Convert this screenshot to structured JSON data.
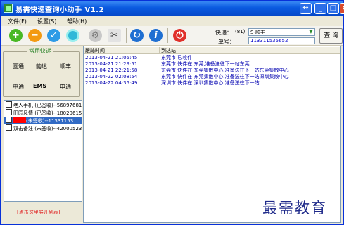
{
  "window": {
    "title": "易需快递查询小助手 V1.2"
  },
  "menu": [
    "文件(F)",
    "设置(S)",
    "帮助(H)"
  ],
  "toolbar_icons": [
    "add-icon",
    "minus-icon",
    "check-icon",
    "circle-icon",
    "gear-icon",
    "tools-icon",
    "refresh-icon",
    "info-icon",
    "power-icon"
  ],
  "query": {
    "courier_label": "快递：",
    "courier_count": "(81)",
    "courier_value": "S-顺丰",
    "number_label": "单号：",
    "number_value": "113311535652",
    "button": "查 询"
  },
  "quick": {
    "title": "常用快递",
    "items": [
      "圆通",
      "韵达",
      "顺丰",
      "中通",
      "EMS",
      "申通"
    ]
  },
  "records": [
    {
      "text": "老人手机 (已签收)--56897681",
      "selected": false
    },
    {
      "text": "田园风情 (已签收)--18020615",
      "selected": false
    },
    {
      "text": "(未签收)--11331153",
      "selected": true
    },
    {
      "text": "双击备注 (未签收)--42000523",
      "selected": false
    }
  ],
  "hide_link": "[点击这里展开列表]",
  "table": {
    "headers": [
      "跟踪时间",
      "到达站"
    ],
    "rows": [
      [
        "2013-04-21 21:05:45",
        "东莞市 已收件"
      ],
      [
        "2013-04-21 21:29:51",
        "东莞市 快件在 东莞,准备送往下一站东莞"
      ],
      [
        "2013-04-21 22:21:58",
        "东莞市 快件在 东莞集散中心,准备送往下一站东莞集散中心"
      ],
      [
        "2013-04-22 02:08:54",
        "东莞市 快件在 东莞集散中心,准备送往下一站深圳集散中心"
      ],
      [
        "2013-04-22 04:35:49",
        "深圳市 快件在 深圳集散中心,准备送往下一站"
      ]
    ]
  },
  "watermark": "最需教育",
  "colors": {
    "title": "#0a5ae0",
    "accent": "#316ac5",
    "text_blue": "#0000b0",
    "link_red": "#e02020"
  }
}
